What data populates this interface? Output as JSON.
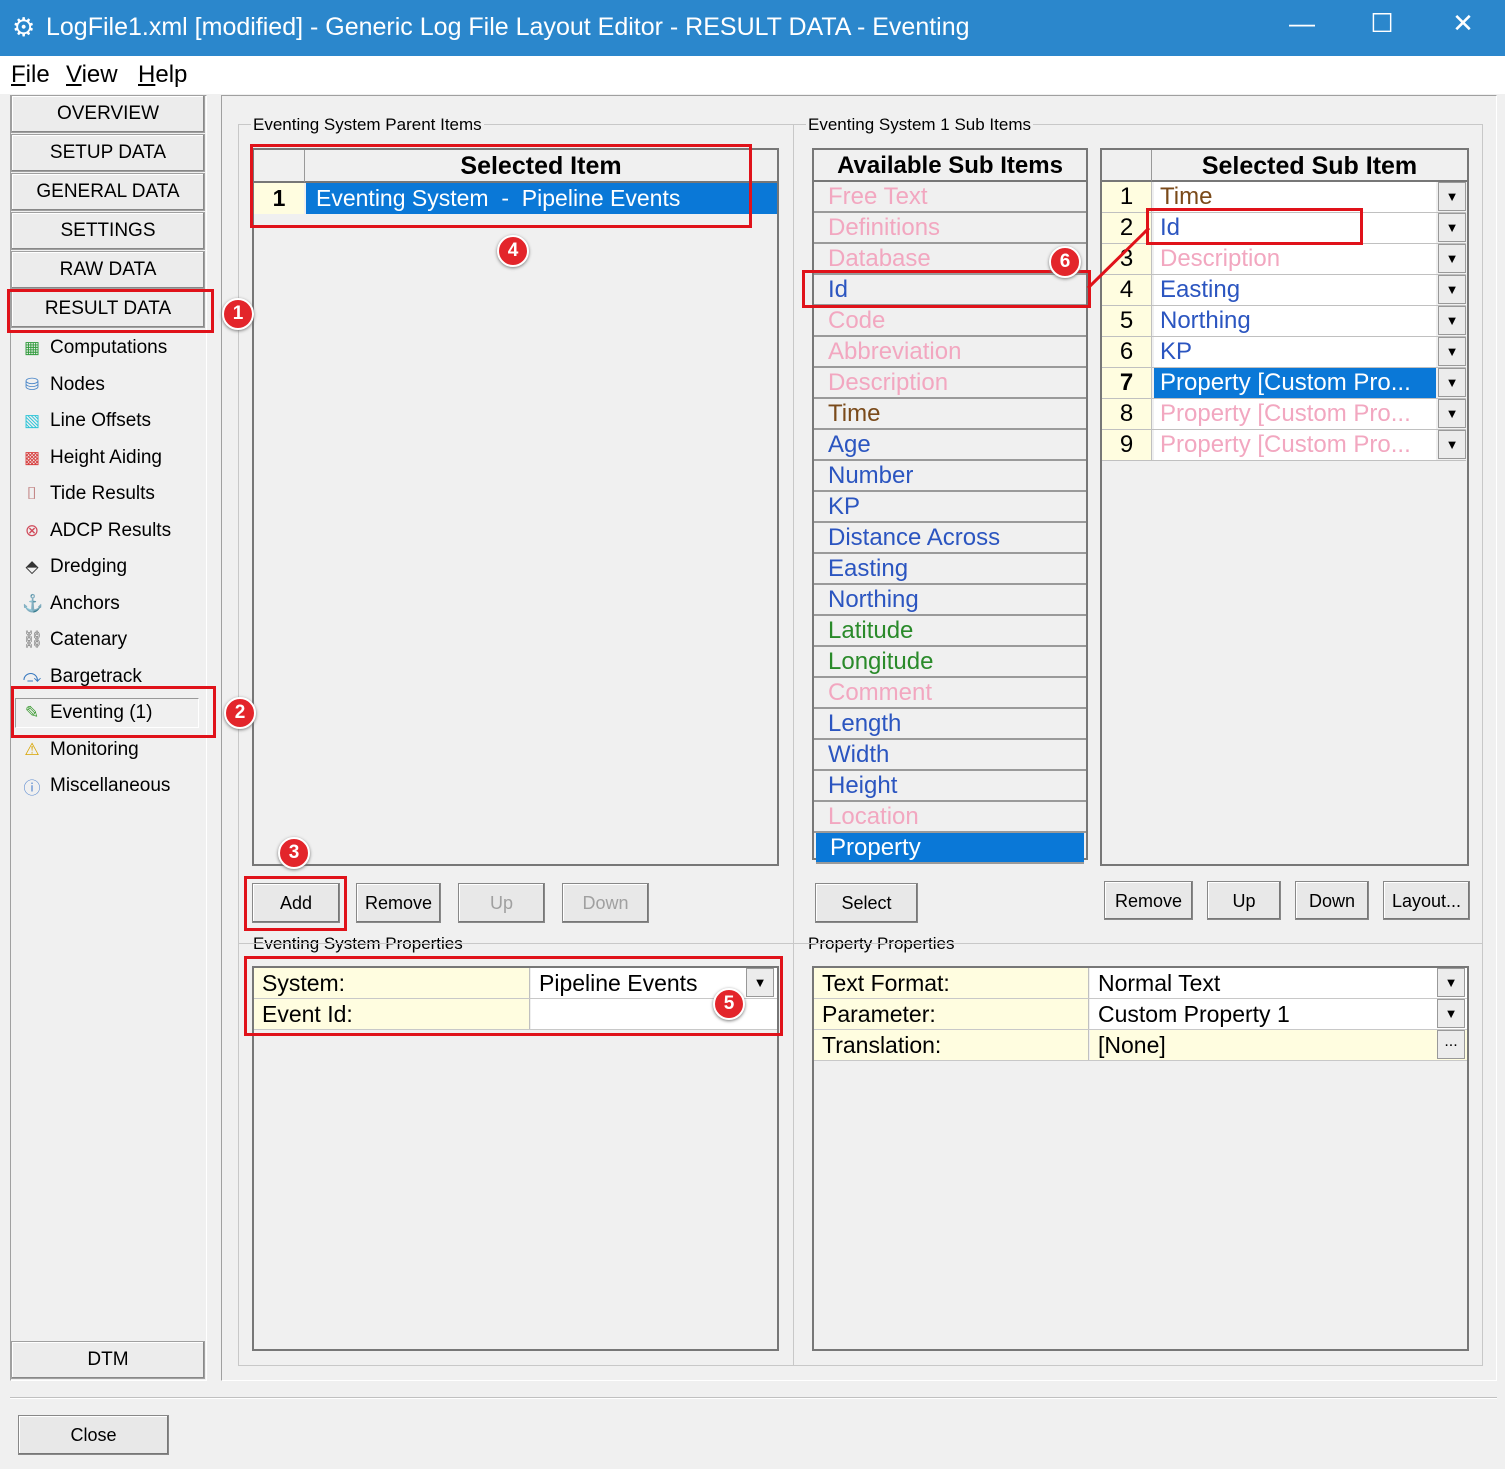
{
  "window": {
    "title": "LogFile1.xml [modified] - Generic Log File Layout Editor -  RESULT DATA -  Eventing",
    "minimize": "—",
    "maximize": "☐",
    "close": "✕"
  },
  "menu": [
    {
      "label": "File",
      "key": "F",
      "rest": "ile"
    },
    {
      "label": "View",
      "key": "V",
      "rest": "iew"
    },
    {
      "label": "Help",
      "key": "H",
      "rest": "elp"
    }
  ],
  "nav": [
    "OVERVIEW",
    "SETUP DATA",
    "GENERAL DATA",
    "SETTINGS",
    "RAW DATA",
    "RESULT DATA"
  ],
  "tree": [
    {
      "label": "Computations",
      "icon": "calculator-icon",
      "glyph": "▦",
      "color": "#2e9a3a"
    },
    {
      "label": "Nodes",
      "icon": "nodes-icon",
      "glyph": "⛁",
      "color": "#4a86c8"
    },
    {
      "label": "Line Offsets",
      "icon": "line-offsets-icon",
      "glyph": "▧",
      "color": "#2cc4d8"
    },
    {
      "label": "Height Aiding",
      "icon": "height-aiding-icon",
      "glyph": "▩",
      "color": "#d84040"
    },
    {
      "label": "Tide Results",
      "icon": "tide-results-icon",
      "glyph": "⌷",
      "color": "#c08080"
    },
    {
      "label": "ADCP Results",
      "icon": "adcp-icon",
      "glyph": "⊗",
      "color": "#d04a5a"
    },
    {
      "label": "Dredging",
      "icon": "dredging-icon",
      "glyph": "⬘",
      "color": "#333"
    },
    {
      "label": "Anchors",
      "icon": "anchor-icon",
      "glyph": "⚓",
      "color": "#aaa"
    },
    {
      "label": "Catenary",
      "icon": "chain-link-icon",
      "glyph": "⛓",
      "color": "#666"
    },
    {
      "label": "Bargetrack",
      "icon": "bargetrack-icon",
      "glyph": "⤼",
      "color": "#3a7ac0"
    },
    {
      "label": "Eventing (1)",
      "icon": "edit-note-icon",
      "glyph": "✎",
      "color": "#3a9a30"
    },
    {
      "label": "Monitoring",
      "icon": "warning-icon",
      "glyph": "⚠",
      "color": "#d8a400"
    },
    {
      "label": "Miscellaneous",
      "icon": "info-icon",
      "glyph": "ⓘ",
      "color": "#5a8ad0"
    }
  ],
  "dtm": "DTM",
  "close_button": "Close",
  "parent": {
    "group_label": "Eventing System Parent Items",
    "header": "Selected Item",
    "rows": [
      {
        "n": "1",
        "value": "Eventing System  -  Pipeline Events"
      }
    ],
    "buttons": {
      "add": "Add",
      "remove": "Remove",
      "up": "Up",
      "down": "Down"
    }
  },
  "props": {
    "group_label": "Eventing System Properties",
    "rows": [
      {
        "label": "System:",
        "value": "Pipeline Events"
      },
      {
        "label": "Event Id:",
        "value": ""
      }
    ]
  },
  "sub": {
    "group_label": "Eventing System 1 Sub Items",
    "available_header": "Available Sub Items",
    "selected_header": "Selected Sub Item",
    "available": [
      {
        "label": "Free Text",
        "color": "#f2a7c0"
      },
      {
        "label": "Definitions",
        "color": "#f2a7c0"
      },
      {
        "label": "Database",
        "color": "#f2a7c0"
      },
      {
        "label": "Id",
        "color": "#2b55c0"
      },
      {
        "label": "Code",
        "color": "#f2a7c0"
      },
      {
        "label": "Abbreviation",
        "color": "#f2a7c0"
      },
      {
        "label": "Description",
        "color": "#f2a7c0"
      },
      {
        "label": "Time",
        "color": "#7a4a1a"
      },
      {
        "label": "Age",
        "color": "#2b55c0"
      },
      {
        "label": "Number",
        "color": "#2b55c0"
      },
      {
        "label": "KP",
        "color": "#2b55c0"
      },
      {
        "label": "Distance Across",
        "color": "#2b55c0"
      },
      {
        "label": "Easting",
        "color": "#2b55c0"
      },
      {
        "label": "Northing",
        "color": "#2b55c0"
      },
      {
        "label": "Latitude",
        "color": "#2a8a2a"
      },
      {
        "label": "Longitude",
        "color": "#2a8a2a"
      },
      {
        "label": "Comment",
        "color": "#f2a7c0"
      },
      {
        "label": "Length",
        "color": "#2b55c0"
      },
      {
        "label": "Width",
        "color": "#2b55c0"
      },
      {
        "label": "Height",
        "color": "#2b55c0"
      },
      {
        "label": "Location",
        "color": "#f2a7c0"
      },
      {
        "label": "Property",
        "color": "#ffffff",
        "selected": true
      }
    ],
    "selected": [
      {
        "n": "1",
        "label": "Time",
        "color": "#7a4a1a"
      },
      {
        "n": "2",
        "label": "Id",
        "color": "#2b55c0"
      },
      {
        "n": "3",
        "label": "Description",
        "color": "#f2a7c0"
      },
      {
        "n": "4",
        "label": "Easting",
        "color": "#2b55c0"
      },
      {
        "n": "5",
        "label": "Northing",
        "color": "#2b55c0"
      },
      {
        "n": "6",
        "label": "KP",
        "color": "#2b55c0"
      },
      {
        "n": "7",
        "label": "Property [Custom Pro...",
        "color": "#ffffff",
        "selected": true
      },
      {
        "n": "8",
        "label": "Property [Custom Pro...",
        "color": "#f2a7c0"
      },
      {
        "n": "9",
        "label": "Property [Custom Pro...",
        "color": "#f2a7c0"
      }
    ],
    "buttons": {
      "select": "Select",
      "remove": "Remove",
      "up": "Up",
      "down": "Down",
      "layout": "Layout..."
    }
  },
  "property_props": {
    "group_label": "Property Properties",
    "rows": [
      {
        "label": "Text Format:",
        "value": "Normal Text",
        "control": "dropdown"
      },
      {
        "label": "Parameter:",
        "value": "Custom Property 1",
        "control": "dropdown"
      },
      {
        "label": "Translation:",
        "value": "[None]",
        "control": "ellipsis",
        "button": "..."
      }
    ]
  },
  "annotations": [
    "1",
    "2",
    "3",
    "4",
    "5",
    "6"
  ],
  "colors": {
    "titlebar": "#2b87cc",
    "selection": "#0a78d7",
    "annotation": "#e0121a"
  }
}
